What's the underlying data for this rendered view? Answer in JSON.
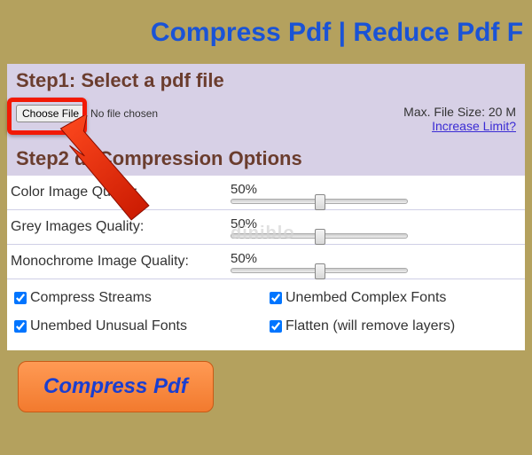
{
  "title": "Compress Pdf | Reduce Pdf F",
  "step1": {
    "header": "Step1: Select a pdf file",
    "choose_btn": "Choose File",
    "no_file": "No file chosen",
    "max_label": "Max. File Size: 20 M",
    "increase_link": "Increase Limit?"
  },
  "step2": {
    "header": "Step2    df Compression Options",
    "sliders": [
      {
        "label": "Color Image Qua   ty:",
        "value": "50%"
      },
      {
        "label": "Grey Images Quality:",
        "value": "50%"
      },
      {
        "label": "Monochrome Image Quality:",
        "value": "50%"
      }
    ],
    "checks": [
      "Compress Streams",
      "Unembed Complex Fonts",
      "Unembed Unusual Fonts",
      "Flatten (will remove layers)"
    ]
  },
  "compress_btn": "Compress Pdf",
  "watermark": "diniblo"
}
